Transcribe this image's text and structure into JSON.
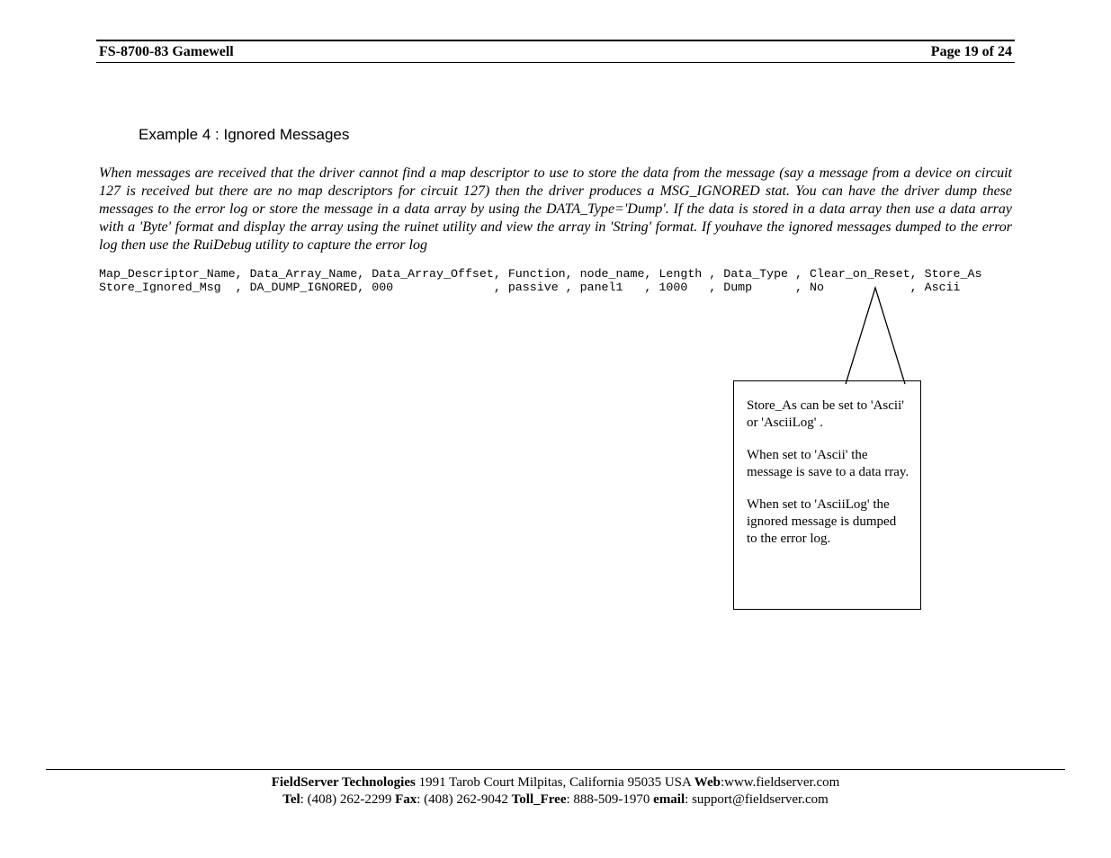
{
  "header": {
    "left": "FS-8700-83 Gamewell",
    "right": "Page 19 of 24"
  },
  "example_title": "Example 4 : Ignored Messages",
  "body_paragraph": "When messages are received that the driver cannot find a map descriptor to use to store the data from the message (say a message from a device on circuit 127 is received but there are no map descriptors for circuit 127) then the driver produces a MSG_IGNORED stat.  You can have the driver dump these messages to the error log or store the message in a data array by using the DATA_Type='Dump'.  If the data is stored in a data array then use a data array with a 'Byte' format and display the array using the ruinet utility and view the array in 'String' format. If youhave the ignored messages dumped to the error log then use the RuiDebug utility to capture the error log",
  "code": {
    "line1": "Map_Descriptor_Name, Data_Array_Name, Data_Array_Offset, Function, node_name, Length , Data_Type , Clear_on_Reset, Store_As",
    "line2": "Store_Ignored_Msg  , DA_DUMP_IGNORED, 000              , passive , panel1   , 1000   , Dump      , No            , Ascii"
  },
  "callout": {
    "p1": "Store_As can be set to 'Ascii' or 'AsciiLog' .",
    "p2": "When set to 'Ascii' the message is save to a data rray.",
    "p3": "When set to 'AsciiLog' the ignored message is dumped to the error log."
  },
  "footer": {
    "company": "FieldServer Technologies",
    "address": " 1991 Tarob Court Milpitas, California 95035 USA  ",
    "web_label": "Web",
    "web_value": ":www.fieldserver.com",
    "tel_label": "Tel",
    "tel_value": ": (408) 262-2299   ",
    "fax_label": "Fax",
    "fax_value": ": (408) 262-9042   ",
    "tollfree_label": "Toll_Free",
    "tollfree_value": ": 888-509-1970   ",
    "email_label": "email",
    "email_value": ": support@fieldserver.com"
  }
}
